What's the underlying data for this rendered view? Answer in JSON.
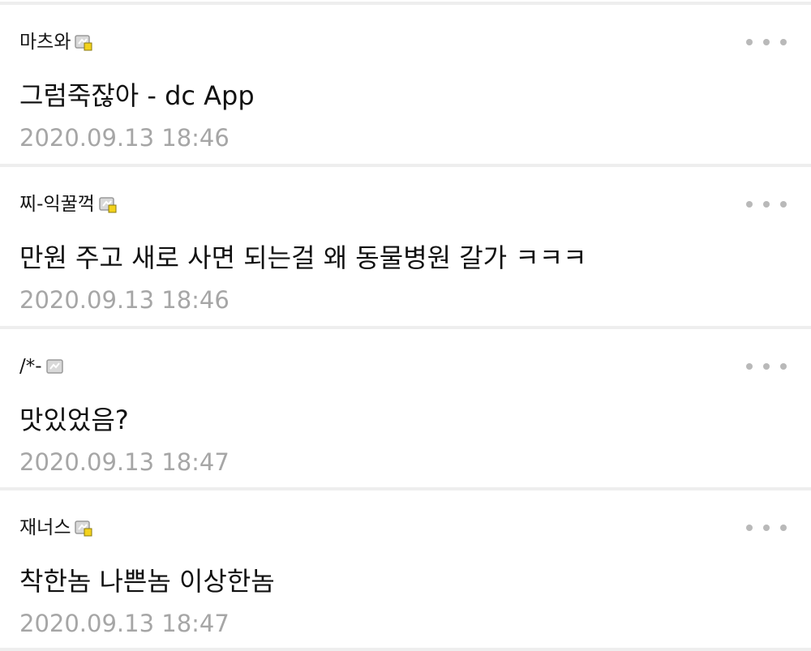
{
  "comments": [
    {
      "nickname": "마츠와",
      "user_icon": "gallog-icon-fixed-nick",
      "text": "그럼죽잖아 - dc App",
      "timestamp": "2020.09.13 18:46"
    },
    {
      "nickname": "찌-익꿀꺽",
      "user_icon": "gallog-icon-fixed-nick",
      "text": "만원 주고 새로 사면 되는걸 왜 동물병원 갈가 ㅋㅋㅋ",
      "timestamp": "2020.09.13 18:46"
    },
    {
      "nickname": "/*-",
      "user_icon": "gallog-icon",
      "text": "맛있었음?",
      "timestamp": "2020.09.13 18:47"
    },
    {
      "nickname": "재너스",
      "user_icon": "gallog-icon-fixed-nick",
      "text": "착한놈 나쁜놈 이상한놈",
      "timestamp": "2020.09.13 18:47"
    }
  ],
  "colors": {
    "text": "#111111",
    "timestamp": "#a6a6a6",
    "divider": "#eeeeee",
    "more_dots": "#b9b9b9",
    "icon_badge": "#f3d21c"
  }
}
